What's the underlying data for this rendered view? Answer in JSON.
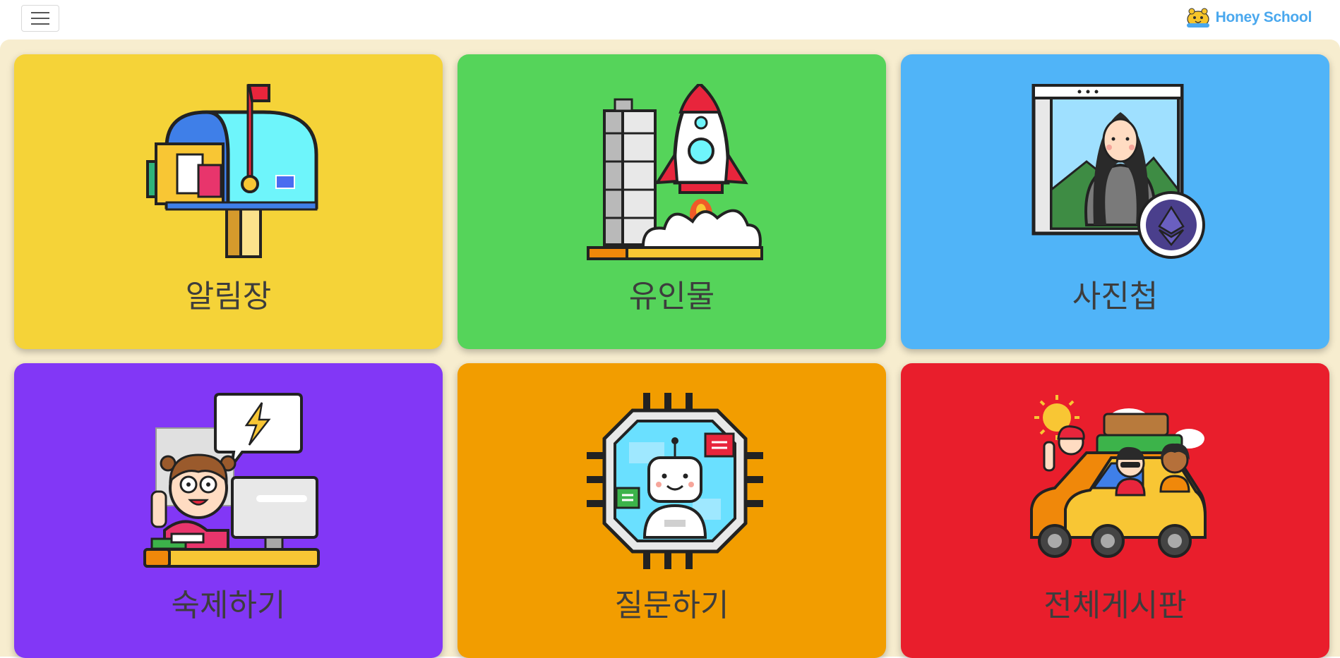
{
  "header": {
    "menu_icon": "hamburger-menu-icon",
    "brand": {
      "logo_icon": "honey-bee-logo-icon",
      "name": "Honey School"
    }
  },
  "cards": [
    {
      "label": "알림장",
      "icon": "mailbox-icon",
      "color": "#f5d338"
    },
    {
      "label": "유인물",
      "icon": "rocket-launch-icon",
      "color": "#55d45a"
    },
    {
      "label": "사진첩",
      "icon": "framed-portrait-icon",
      "color": "#50b4f8"
    },
    {
      "label": "숙제하기",
      "icon": "student-at-computer-icon",
      "color": "#8237f6"
    },
    {
      "label": "질문하기",
      "icon": "robot-chip-icon",
      "color": "#f29d00"
    },
    {
      "label": "전체게시판",
      "icon": "road-trip-car-icon",
      "color": "#e91e2c"
    }
  ]
}
